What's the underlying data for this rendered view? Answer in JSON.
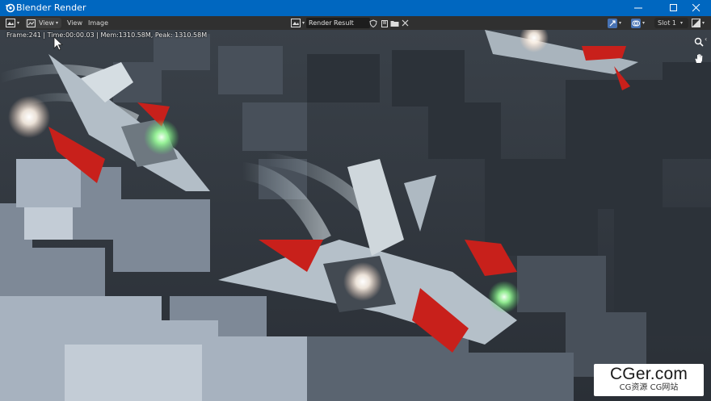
{
  "window": {
    "title": "Blender Render",
    "icon": "blender-icon",
    "controls": [
      "minimize-icon",
      "maximize-icon",
      "close-icon"
    ]
  },
  "header": {
    "editor_type_icon": "image-editor-icon",
    "view_mode": {
      "label": "View",
      "icon": "view-mode-icon"
    },
    "menus": {
      "view": "View",
      "image": "Image"
    },
    "image": {
      "name": "Render Result",
      "browse_icon": "image-browse-icon"
    },
    "image_actions": [
      "fake-user-icon",
      "new-image-icon",
      "open-folder-icon",
      "unlink-icon"
    ],
    "gizmo_icon": "gizmo-icon",
    "overlay_icon": "overlay-icon",
    "slot": "Slot 1",
    "display_channels_icon": "display-channels-icon"
  },
  "render_stats": "Frame:241 | Time:00:00.03 | Mem:1310.58M, Peak: 1310.58M",
  "navigation": {
    "zoom_icon": "zoom-icon",
    "pan_icon": "hand-pan-icon",
    "collapse_icon": "chevron-left-icon"
  },
  "watermark": {
    "logo": "CGer.com",
    "subtitle": "CG资源 CG网站"
  },
  "colors": {
    "titlebar": "#0067c0",
    "header": "#303030",
    "accent_red": "#c8201b",
    "engine_glow": "#ffffff",
    "engine_green": "#9cff9a"
  }
}
